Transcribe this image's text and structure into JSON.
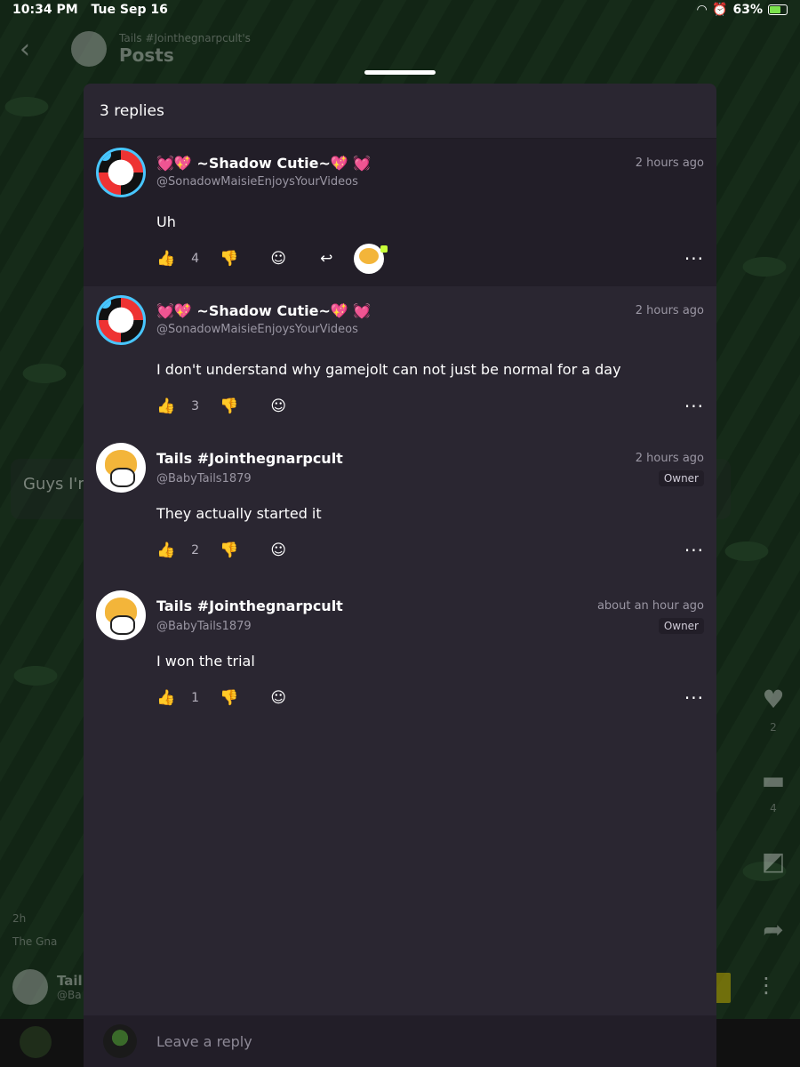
{
  "status_bar": {
    "time": "10:34 PM",
    "date": "Tue Sep 16",
    "battery": "63%"
  },
  "background": {
    "nav_subtitle": "Tails #Jointhegnarpcult's",
    "nav_title": "Posts",
    "post_text_partial": "Guys I'm",
    "post_time": "2h",
    "community_partial": "The Gna",
    "author_partial": "Tail",
    "author_handle_partial": "@Ba",
    "like_count": "2",
    "comment_count": "4"
  },
  "sheet": {
    "header": "3 replies",
    "comments": [
      {
        "name": "💓💖 ~Shadow Cutie~💖 💓",
        "username": "@SonadowMaisieEnjoysYourVideos",
        "time": "2 hours ago",
        "body": "Uh",
        "likes": "4",
        "owner": ""
      },
      {
        "name": "💓💖 ~Shadow Cutie~💖 💓",
        "username": "@SonadowMaisieEnjoysYourVideos",
        "time": "2 hours ago",
        "body": "I don't understand why gamejolt can not just be normal for a day",
        "likes": "3",
        "owner": ""
      },
      {
        "name": "Tails #Jointhegnarpcult",
        "username": "@BabyTails1879",
        "time": "2 hours ago",
        "body": "They actually started it",
        "likes": "2",
        "owner": "Owner"
      },
      {
        "name": "Tails #Jointhegnarpcult",
        "username": "@BabyTails1879",
        "time": "about an hour ago",
        "body": "I won the trial",
        "likes": "1",
        "owner": "Owner"
      }
    ]
  },
  "reply_bar": {
    "placeholder": "Leave a reply"
  },
  "icons": {
    "like": "thumbs-up-icon",
    "dislike": "thumbs-down-icon",
    "react": "add-reaction-icon",
    "reply": "reply-arrow-icon",
    "more": "more-dots-icon"
  }
}
